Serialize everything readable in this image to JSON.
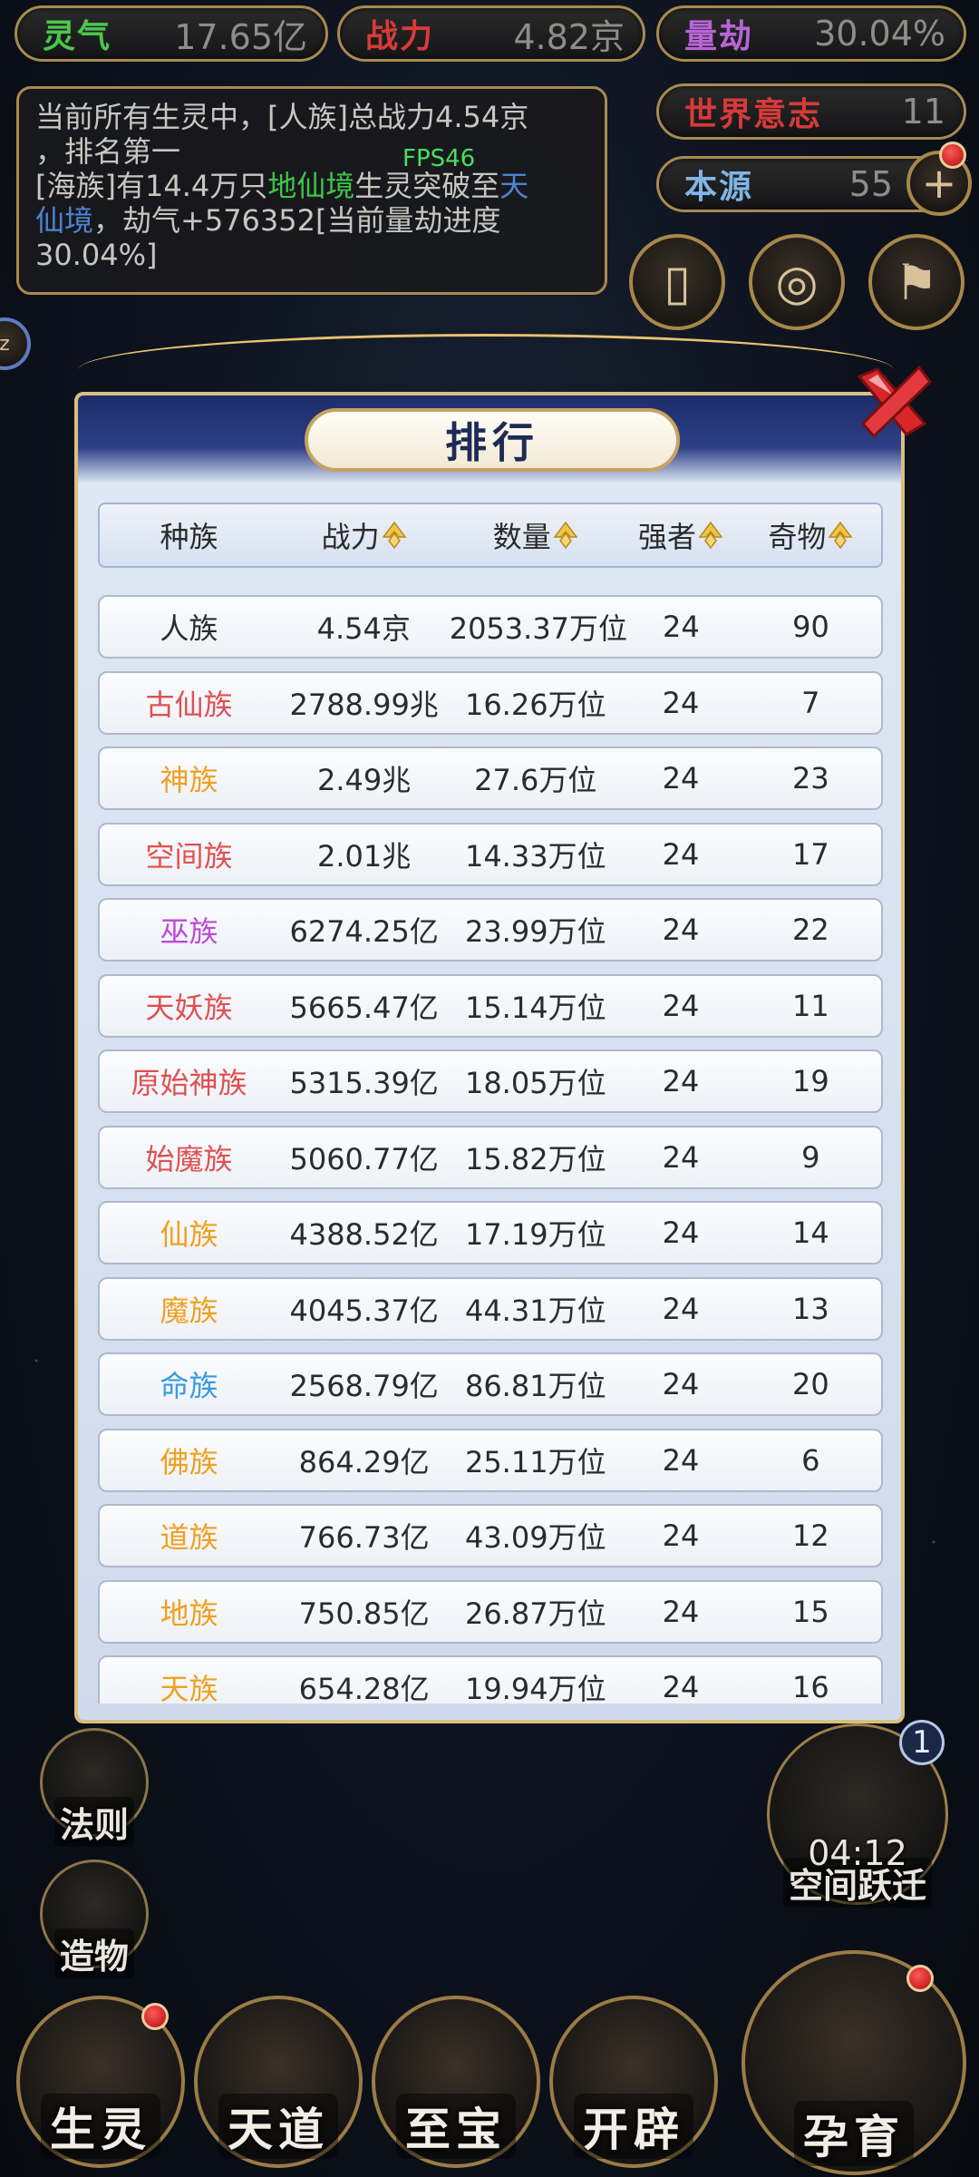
{
  "top_stats": [
    {
      "label": "灵气",
      "value": "17.65亿",
      "color": "#4bc74d"
    },
    {
      "label": "战力",
      "value": "4.82京",
      "color": "#d83a3a"
    },
    {
      "label": "量劫",
      "value": "30.04%",
      "color": "#b865d8"
    },
    {
      "label": "世界意志",
      "value": "11",
      "color": "#d83a3a"
    },
    {
      "label": "本源",
      "value": "55",
      "color": "#7fb6e6"
    }
  ],
  "event_log": {
    "line1": "当前所有生灵中，[人族]总战力4.54京",
    "line2": "，排名第一",
    "line3_a": "[海族]有14.4万只",
    "line3_b": "地仙境",
    "line3_c": "生灵突破至",
    "line3_d": "天",
    "line4_a": "仙境",
    "line4_b": "，劫气+576352[当前量劫进度",
    "line5": "30.04%]"
  },
  "fps": "FPS46",
  "panel": {
    "title": "排行",
    "columns": [
      "种族",
      "战力",
      "数量",
      "强者",
      "奇物"
    ]
  },
  "rankings": [
    {
      "race": "人族",
      "power": "4.54京",
      "count": "2053.37万位",
      "strong": "24",
      "items": "90",
      "color": "#2b2b2b"
    },
    {
      "race": "古仙族",
      "power": "2788.99兆",
      "count": "16.26万位",
      "strong": "24",
      "items": "7",
      "color": "#e05050"
    },
    {
      "race": "神族",
      "power": "2.49兆",
      "count": "27.6万位",
      "strong": "24",
      "items": "23",
      "color": "#f0a020"
    },
    {
      "race": "空间族",
      "power": "2.01兆",
      "count": "14.33万位",
      "strong": "24",
      "items": "17",
      "color": "#e05050"
    },
    {
      "race": "巫族",
      "power": "6274.25亿",
      "count": "23.99万位",
      "strong": "24",
      "items": "22",
      "color": "#c048d8"
    },
    {
      "race": "天妖族",
      "power": "5665.47亿",
      "count": "15.14万位",
      "strong": "24",
      "items": "11",
      "color": "#e05050"
    },
    {
      "race": "原始神族",
      "power": "5315.39亿",
      "count": "18.05万位",
      "strong": "24",
      "items": "19",
      "color": "#e05050"
    },
    {
      "race": "始魔族",
      "power": "5060.77亿",
      "count": "15.82万位",
      "strong": "24",
      "items": "9",
      "color": "#e05050"
    },
    {
      "race": "仙族",
      "power": "4388.52亿",
      "count": "17.19万位",
      "strong": "24",
      "items": "14",
      "color": "#f0a020"
    },
    {
      "race": "魔族",
      "power": "4045.37亿",
      "count": "44.31万位",
      "strong": "24",
      "items": "13",
      "color": "#f0a020"
    },
    {
      "race": "命族",
      "power": "2568.79亿",
      "count": "86.81万位",
      "strong": "24",
      "items": "20",
      "color": "#3a9ae0"
    },
    {
      "race": "佛族",
      "power": "864.29亿",
      "count": "25.11万位",
      "strong": "24",
      "items": "6",
      "color": "#f0a020"
    },
    {
      "race": "道族",
      "power": "766.73亿",
      "count": "43.09万位",
      "strong": "24",
      "items": "12",
      "color": "#f0a020"
    },
    {
      "race": "地族",
      "power": "750.85亿",
      "count": "26.87万位",
      "strong": "24",
      "items": "15",
      "color": "#f0a020"
    },
    {
      "race": "天族",
      "power": "654.28亿",
      "count": "19.94万位",
      "strong": "24",
      "items": "16",
      "color": "#f0a020"
    }
  ],
  "side_buttons": {
    "law": "法则",
    "create": "造物",
    "space_jump": "空间跃迁",
    "space_jump_timer": "04:12",
    "space_jump_badge": "1"
  },
  "bottom_nav": [
    "生灵",
    "天道",
    "至宝",
    "开辟",
    "孕育"
  ]
}
